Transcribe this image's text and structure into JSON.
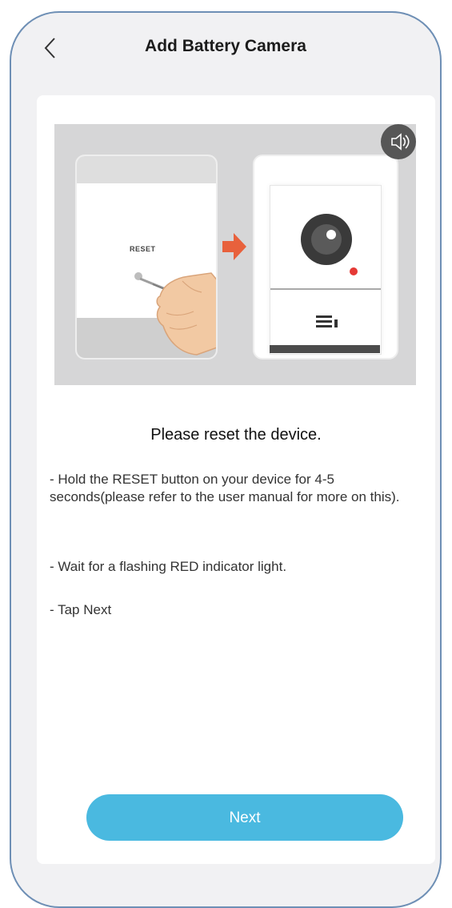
{
  "header": {
    "title": "Add Battery Camera",
    "back_icon": "chevron-left-icon"
  },
  "illustration": {
    "reset_label": "RESET",
    "speaker_icon": "speaker-icon",
    "arrow_color": "#e8613c",
    "indicator_color": "#e53935"
  },
  "content": {
    "heading": "Please reset the device.",
    "instructions": [
      "- Hold the RESET button on your device for 4-5 seconds(please refer to the user manual for more on this).",
      "- Wait for a flashing RED indicator light.",
      "- Tap Next"
    ]
  },
  "footer": {
    "next_label": "Next"
  },
  "colors": {
    "accent": "#4ab9e0",
    "frame": "#6e8fb5",
    "background": "#f1f1f3"
  }
}
